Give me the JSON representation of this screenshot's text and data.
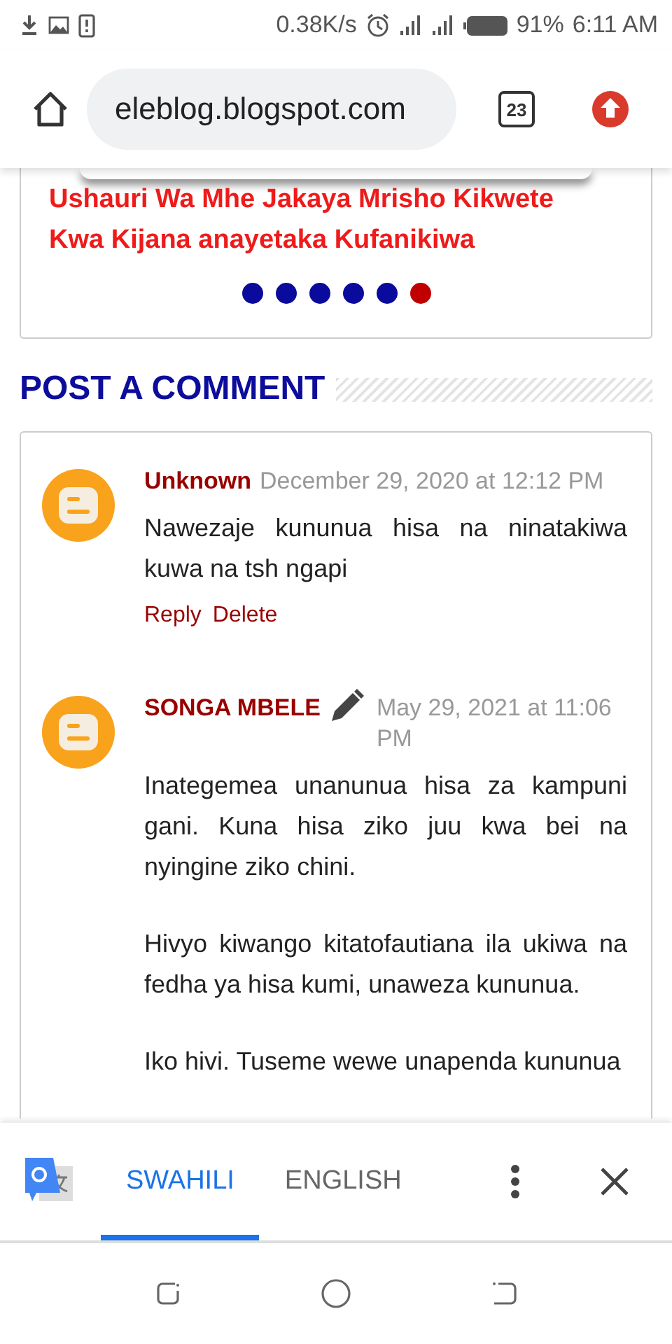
{
  "status_bar": {
    "net_speed": "0.38K/s",
    "battery": "91%",
    "time": "6:11 AM"
  },
  "browser": {
    "url": "eleblog.blogspot.com",
    "tab_count": "23"
  },
  "post_card": {
    "title": "Ushauri Wa Mhe Jakaya Mrisho Kikwete Kwa Kijana anayetaka Kufanikiwa",
    "dots": [
      {
        "selected": false
      },
      {
        "selected": false
      },
      {
        "selected": false
      },
      {
        "selected": false
      },
      {
        "selected": false
      },
      {
        "selected": true
      }
    ]
  },
  "comments_heading": "POST A COMMENT",
  "comments": [
    {
      "author": "Unknown",
      "edit_icon": false,
      "date": "December 29, 2020 at 12:12 PM",
      "paragraphs": [
        "Nawezaje kununua hisa na ninatakiwa kuwa na tsh ngapi"
      ],
      "actions": [
        "Reply",
        "Delete"
      ]
    },
    {
      "author": "SONGA MBELE",
      "edit_icon": true,
      "date": "May 29, 2021 at 11:06 PM",
      "paragraphs": [
        "Inategemea unanunua hisa za kampuni gani. Kuna hisa ziko juu kwa bei na nyingine ziko chini.",
        "Hivyo kiwango kitatofautiana ila ukiwa na fedha ya hisa kumi, unaweza kununua.",
        "Iko hivi. Tuseme wewe unapenda kununua"
      ]
    }
  ],
  "translate_bar": {
    "tabs": [
      {
        "label": "SWAHILI",
        "selected": true
      },
      {
        "label": "ENGLISH",
        "selected": false
      }
    ]
  }
}
